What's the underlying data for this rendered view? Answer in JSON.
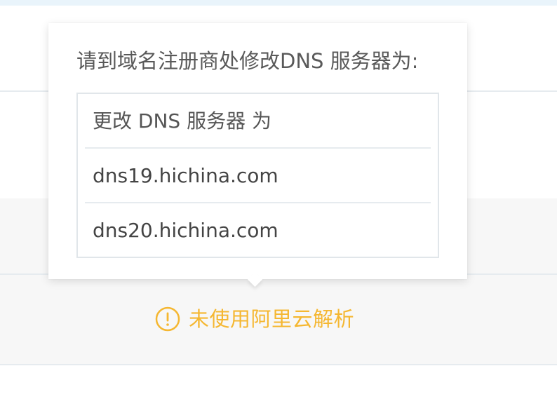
{
  "popover": {
    "title": "请到域名注册商处修改DNS 服务器为:",
    "table": {
      "header": "更改 DNS 服务器 为",
      "rows": [
        "dns19.hichina.com",
        "dns20.hichina.com"
      ]
    }
  },
  "status": {
    "icon": "warning-circle-icon",
    "text": "未使用阿里云解析",
    "color": "#f5b731"
  }
}
